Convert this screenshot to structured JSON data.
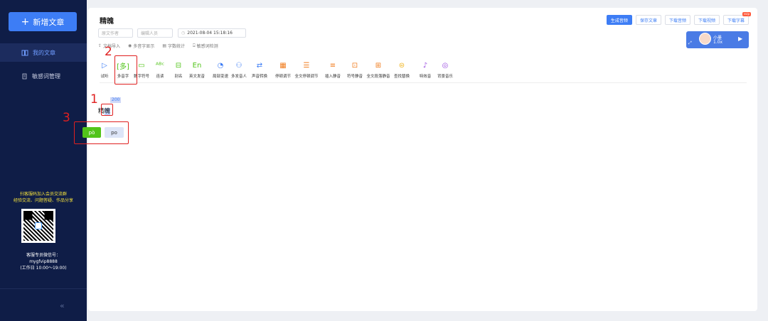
{
  "sidebar": {
    "new_article": "新增文章",
    "items": [
      {
        "label": "我的文章",
        "active": true
      },
      {
        "label": "敏感词管理",
        "active": false
      }
    ],
    "promo_lines": [
      "扫客服码加入会员交流群",
      "经验交流、问题答疑、作品分享"
    ],
    "service_lines": [
      "客服专员微信号：",
      "mygfvip8888",
      "(工作日 10:00～19:00)"
    ],
    "collapse_glyph": "«"
  },
  "editor": {
    "title": "精魄",
    "author_placeholder": "原文作者",
    "editor_placeholder": "编辑人员",
    "date": "2021-08-04 15:18:16",
    "links": [
      "文档导入",
      "多音字显示",
      "字数统计",
      "敏感词检测"
    ]
  },
  "topbar": {
    "buttons": [
      "生成音频",
      "保存文章",
      "下载音频",
      "下载视频",
      "下载字幕"
    ],
    "svip": "svip"
  },
  "player": {
    "name": "小墨",
    "speed": "1.0x"
  },
  "tools": [
    {
      "label": "试听",
      "color": "#3d7df5"
    },
    {
      "label": "多音字",
      "color": "#52c41a"
    },
    {
      "label": "数字符号",
      "color": "#52c41a"
    },
    {
      "label": "连读",
      "color": "#52c41a"
    },
    {
      "label": "别名",
      "color": "#52c41a"
    },
    {
      "label": "英文发音",
      "color": "#52c41a"
    },
    {
      "label": "局部变速",
      "color": "#3d7df5"
    },
    {
      "label": "多发音人",
      "color": "#3d7df5"
    },
    {
      "label": "声音转换",
      "color": "#3d7df5"
    },
    {
      "label": "停顿调节",
      "color": "#f07c1e"
    },
    {
      "label": "全文停顿调节",
      "color": "#f07c1e"
    },
    {
      "label": "插入静音",
      "color": "#f07c1e"
    },
    {
      "label": "符号静音",
      "color": "#f07c1e"
    },
    {
      "label": "全文段落静音",
      "color": "#f07c1e"
    },
    {
      "label": "查找替换",
      "color": "#f0b41e"
    },
    {
      "label": "特效音",
      "color": "#9b4fe0"
    },
    {
      "label": "背景音乐",
      "color": "#9b4fe0"
    }
  ],
  "content": {
    "badge": "200",
    "word_first": "精",
    "word_second": "魄",
    "pinyin_selected": "pò",
    "pinyin_alt": "po"
  },
  "annotations": [
    "1",
    "2",
    "3"
  ],
  "colors": {
    "accent": "#3d7df5",
    "sidebar": "#0f1d47",
    "selected": "#52c41a",
    "annotation": "#e02020"
  }
}
